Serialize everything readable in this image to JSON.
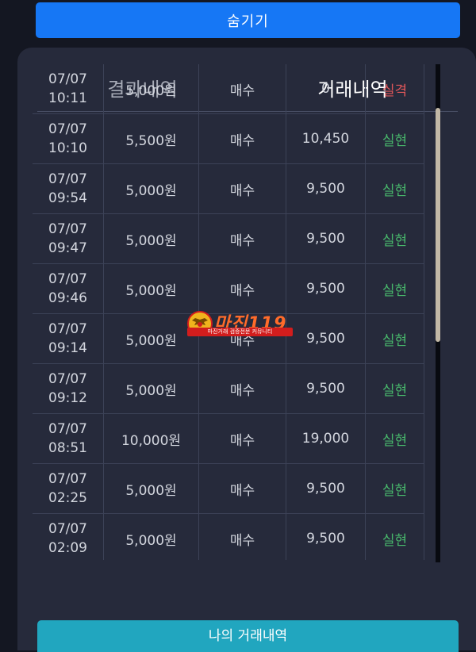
{
  "hide_button": {
    "label": "숨기기"
  },
  "tabs": [
    {
      "label": "결과내역",
      "active": false
    },
    {
      "label": "거래내역",
      "active": true
    }
  ],
  "rows": [
    {
      "date": "07/07",
      "time": "10:11",
      "amount": "5,000원",
      "type": "매수",
      "result": "0",
      "status": "실격",
      "status_kind": "fail"
    },
    {
      "date": "07/07",
      "time": "10:10",
      "amount": "5,500원",
      "type": "매수",
      "result": "10,450",
      "status": "실현",
      "status_kind": "ok"
    },
    {
      "date": "07/07",
      "time": "09:54",
      "amount": "5,000원",
      "type": "매수",
      "result": "9,500",
      "status": "실현",
      "status_kind": "ok"
    },
    {
      "date": "07/07",
      "time": "09:47",
      "amount": "5,000원",
      "type": "매수",
      "result": "9,500",
      "status": "실현",
      "status_kind": "ok"
    },
    {
      "date": "07/07",
      "time": "09:46",
      "amount": "5,000원",
      "type": "매수",
      "result": "9,500",
      "status": "실현",
      "status_kind": "ok"
    },
    {
      "date": "07/07",
      "time": "09:14",
      "amount": "5,000원",
      "type": "매수",
      "result": "9,500",
      "status": "실현",
      "status_kind": "ok"
    },
    {
      "date": "07/07",
      "time": "09:12",
      "amount": "5,000원",
      "type": "매수",
      "result": "9,500",
      "status": "실현",
      "status_kind": "ok"
    },
    {
      "date": "07/07",
      "time": "08:51",
      "amount": "10,000원",
      "type": "매수",
      "result": "19,000",
      "status": "실현",
      "status_kind": "ok"
    },
    {
      "date": "07/07",
      "time": "02:25",
      "amount": "5,000원",
      "type": "매수",
      "result": "9,500",
      "status": "실현",
      "status_kind": "ok"
    },
    {
      "date": "07/07",
      "time": "02:09",
      "amount": "5,000원",
      "type": "매수",
      "result": "9,500",
      "status": "실현",
      "status_kind": "ok"
    }
  ],
  "my_trades_button": {
    "label": "나의 거래내역"
  },
  "watermark": {
    "title": "마진119",
    "subtitle": "마진거래 검증전문 커뮤니티"
  },
  "colors": {
    "primary_button": "#1677f5",
    "secondary_button": "#21a6bf",
    "status_ok": "#48b86b",
    "status_fail": "#e0575a",
    "panel": "#262a3b"
  }
}
